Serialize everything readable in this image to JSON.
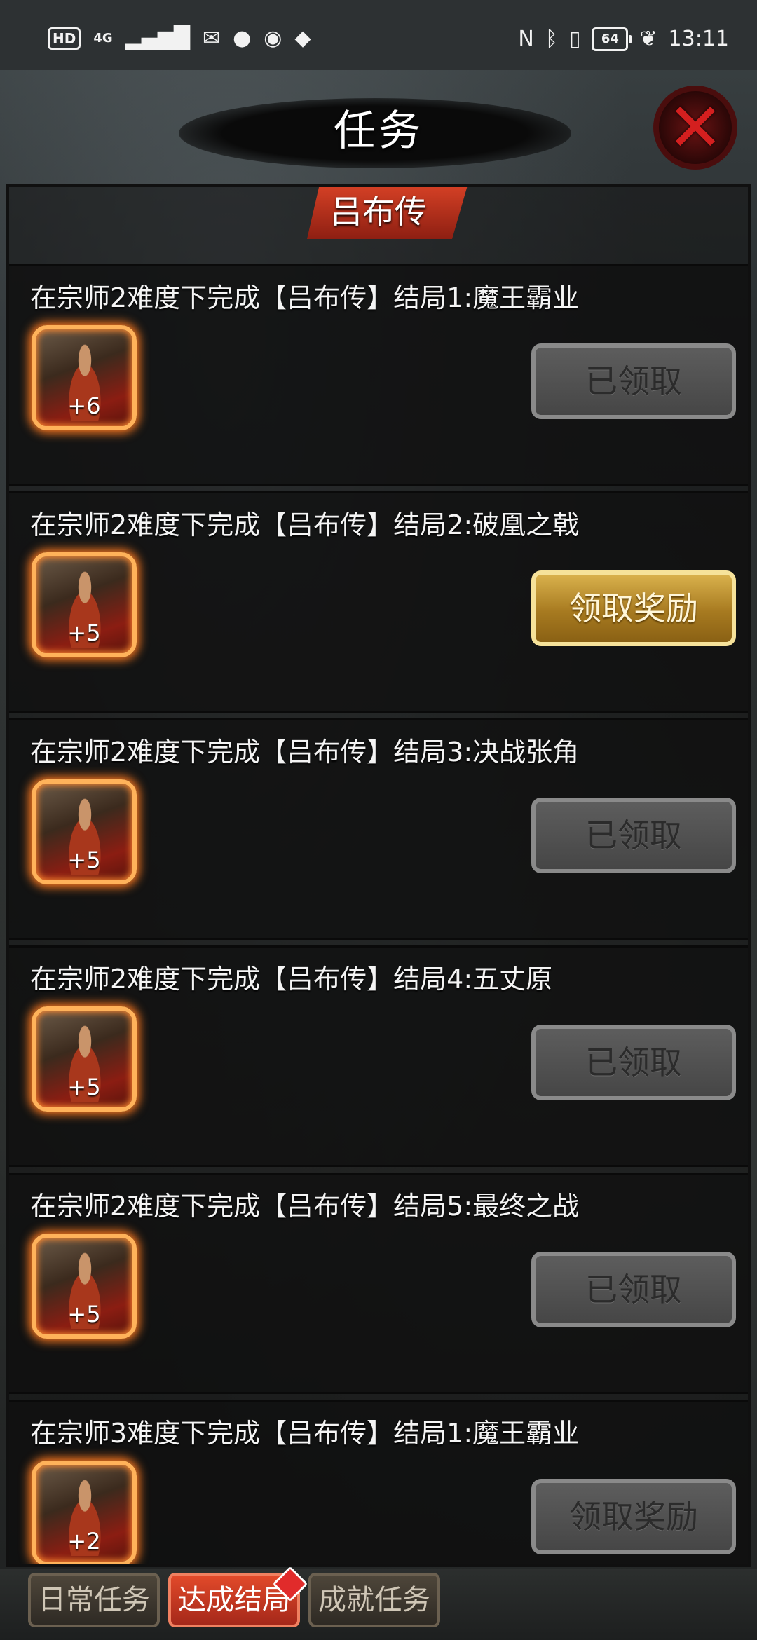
{
  "status_bar": {
    "left_icons": [
      "HD",
      "4G",
      "signal-icon",
      "message-icon",
      "chat-icon",
      "voice-icon",
      "app-icon"
    ],
    "hd": "HD",
    "net": "4G",
    "battery": "64",
    "time": "13:11"
  },
  "header": {
    "title": "任务",
    "close_glyph": "✕"
  },
  "section": {
    "title": "吕布传"
  },
  "tasks": [
    {
      "title": "在宗师2难度下完成【吕布传】结局1:魔王霸业",
      "reward": "+6",
      "button": "已领取",
      "state": "claimed"
    },
    {
      "title": "在宗师2难度下完成【吕布传】结局2:破凰之戟",
      "reward": "+5",
      "button": "领取奖励",
      "state": "claimable"
    },
    {
      "title": "在宗师2难度下完成【吕布传】结局3:决战张角",
      "reward": "+5",
      "button": "已领取",
      "state": "claimed"
    },
    {
      "title": "在宗师2难度下完成【吕布传】结局4:五丈原",
      "reward": "+5",
      "button": "已领取",
      "state": "claimed"
    },
    {
      "title": "在宗师2难度下完成【吕布传】结局5:最终之战",
      "reward": "+5",
      "button": "已领取",
      "state": "claimed"
    },
    {
      "title": "在宗师3难度下完成【吕布传】结局1:魔王霸业",
      "reward": "+2",
      "button": "领取奖励",
      "state": "locked"
    }
  ],
  "bottom_tabs": [
    {
      "label": "日常任务",
      "active": false
    },
    {
      "label": "达成结局",
      "active": true
    },
    {
      "label": "成就任务",
      "active": false
    }
  ],
  "colors": {
    "accent_red": "#d84226",
    "gold": "#d9b14c",
    "glow": "#ff7a20"
  }
}
